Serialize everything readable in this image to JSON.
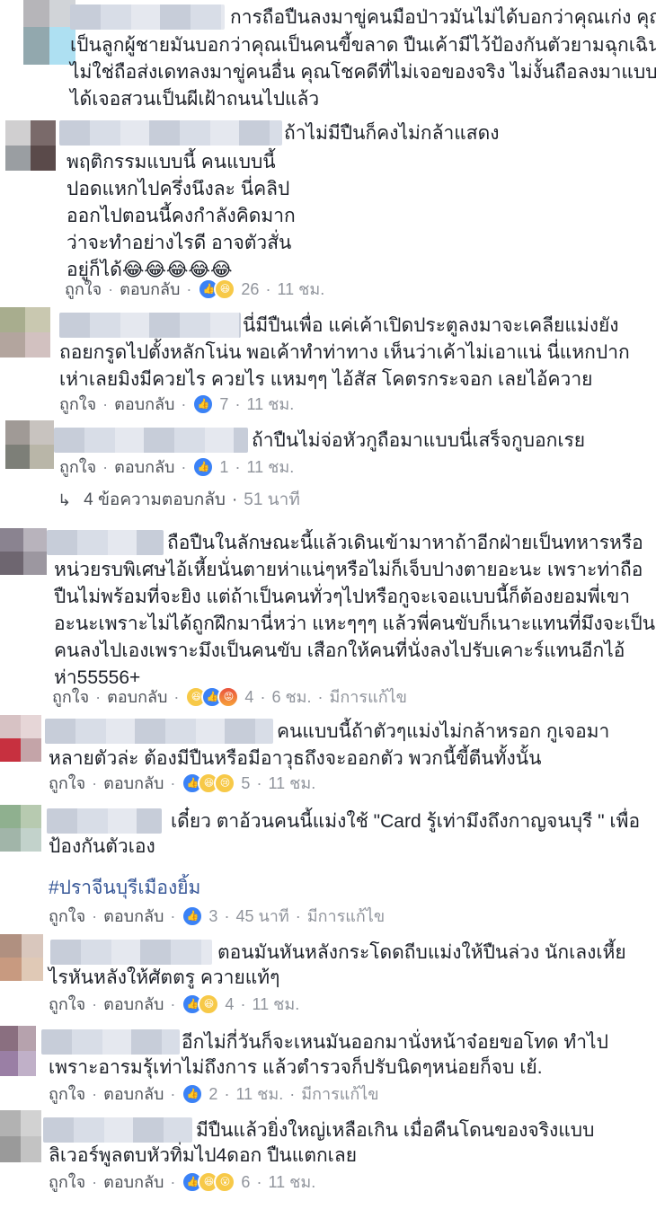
{
  "comments": [
    {
      "avatar_colors": [
        "#b6b5b9",
        "#d1d4d8",
        "#92a8ae",
        "#aee0f2"
      ],
      "text_lines": [
        "การถือปืนลงมาขู่คนมือป่าวมันไม่ได้บอกว่าคุณเก่ง คุณ",
        "เป็นลูกผู้ชายมันบอกว่าคุณเป็นคนขี้ขลาด ปืนเค้ามีไว้ป้องกันตัวยามฉุกเฉิน",
        "ไม่ใช่ถือส่งเดทลงมาขู่คนอื่น คุณโชคดีที่ไม่เจอของจริง ไม่งั้นถือลงมาแบบนี้",
        "ได้เจอสวนเป็นผีเฝ้าถนนไปแล้ว"
      ]
    },
    {
      "avatar_colors": [
        "#d0cfd0",
        "#7a6a6a",
        "#9a9ea2",
        "#5a4a4a"
      ],
      "text_lines": [
        "ถ้าไม่มีปืนก็คงไม่กล้าแสดง",
        "พฤติกรรมแบบนี้ คนแบบนี้",
        "ปอดแหกไปครึ่งนึงละ นี่คลิป",
        "ออกไปตอนนี้คงกำลังคิดมาก",
        "ว่าจะทำอย่างไรดี อาจตัวสั่น",
        "อยู่ก็ได้"
      ],
      "emoji_tail": "😂😂😂😂😂",
      "actions": {
        "like": "ถูกใจ",
        "reply": "ตอบกลับ"
      },
      "reactions": [
        "like",
        "haha"
      ],
      "count": "26",
      "time": "11 ชม."
    },
    {
      "avatar_colors": [
        "#a8ad8e",
        "#c9c8b0",
        "#b3a59e",
        "#d2c1c0"
      ],
      "text_lines": [
        "นี่มีปืนเพื่อ แค่เค้าเปิดประตูลงมาจะเคลียแม่งยัง",
        "ถอยกรูดไปตั้งหลักโน่น พอเค้าทำท่าทาง เห็นว่าเค้าไม่เอาแน่ นี่แหกปาก",
        "เห่าเลยมิงมีควยไร ควยไร แหมๆๆ ไอ้สัส โคตรกระจอก เลยไอ้ควาย"
      ],
      "actions": {
        "like": "ถูกใจ",
        "reply": "ตอบกลับ"
      },
      "reactions": [
        "like"
      ],
      "count": "7",
      "time": "11 ชม."
    },
    {
      "avatar_colors": [
        "#a09a96",
        "#c8c3bf",
        "#7d7f78",
        "#b9b6a8"
      ],
      "text_lines": [
        "ถ้าปืนไม่จ่อหัวกูถือมาแบบนี่เสร็จกูบอกเรย"
      ],
      "actions": {
        "like": "ถูกใจ",
        "reply": "ตอบกลับ"
      },
      "reactions": [
        "like"
      ],
      "count": "1",
      "time": "11 ชม."
    },
    {
      "avatar_colors": [
        "#8a8390",
        "#b8b3bc",
        "#6e6670",
        "#9c97a0"
      ],
      "text_lines": [
        "ถือปืนในลักษณะนี้แล้วเดินเข้ามาหาถ้าอีกฝ่ายเป็นทหารหรือ",
        "หน่วยรบพิเศษไอ้เหี้ยนั่นตายห่าแน่ๆหรือไม่ก็เจ็บปางตายอะนะ เพราะท่าถือ",
        "ปืนไม่พร้อมที่จะยิง แต่ถ้าเป็นคนทั่วๆไปหรือกูจะเจอแบบนี้ก็ต้องยอมพี่เขา",
        "อะนะเพราะไม่ได้ถูกฝึกมานี่หว่า แหะๆๆๆ แล้วพี่คนขับก็เนาะแทนที่มึงจะเป็น",
        "คนลงไปเองเพราะมึงเป็นคนขับ เสือกให้คนที่นั่งลงไปรับเคาะร์แทนอีกไอ้",
        "ห่า55556+"
      ],
      "actions": {
        "like": "ถูกใจ",
        "reply": "ตอบกลับ"
      },
      "reactions": [
        "haha",
        "like",
        "angry"
      ],
      "count": "4",
      "time": "6 ชม.",
      "edited": "มีการแก้ไข"
    },
    {
      "avatar_colors": [
        "#d7c2c4",
        "#e6d6d7",
        "#c7303f",
        "#c4a4a8"
      ],
      "text_lines": [
        "คนแบบนี้ถ้าตัวๆแม่งไม่กล้าหรอก กูเจอมา",
        "หลายตัวล่ะ ต้องมีปืนหรือมีอาวุธถึงจะออกตัว พวกนี้ขี้ตีนทั้งนั้น"
      ],
      "actions": {
        "like": "ถูกใจ",
        "reply": "ตอบกลับ"
      },
      "reactions": [
        "like",
        "haha",
        "sad"
      ],
      "count": "5",
      "time": "11 ชม."
    },
    {
      "avatar_colors": [
        "#8fb08f",
        "#b7cab0",
        "#a1b5a9",
        "#c2d2cb"
      ],
      "text_lines": [
        "เดี๋ยว ตาอ้วนคนนี้แม่งใช้ \"Card รู้เท่ามึงถึงกาญจนบุรี \" เพื่อ",
        "ป้องกันตัวเอง"
      ],
      "hashtag": "#ปราจีนบุรีเมืองยิ้ม",
      "actions": {
        "like": "ถูกใจ",
        "reply": "ตอบกลับ"
      },
      "reactions": [
        "like"
      ],
      "count": "3",
      "time": "45 นาที",
      "edited": "มีการแก้ไข"
    },
    {
      "avatar_colors": [
        "#b09080",
        "#d9c7bd",
        "#c89a80",
        "#e0c9b6"
      ],
      "text_lines": [
        "ตอนมันหันหลังกระโดดถีบแม่งให้ปืนล่วง นักเลงเหี้ย",
        "ไรหันหลังให้ศัตตรู ควายแท้ๆ"
      ],
      "actions": {
        "like": "ถูกใจ",
        "reply": "ตอบกลับ"
      },
      "reactions": [
        "like",
        "haha"
      ],
      "count": "4",
      "time": "11 ชม."
    },
    {
      "avatar_colors": [
        "#8a6f80",
        "#b6a2ad",
        "#9a7fa5",
        "#c0b0c8"
      ],
      "text_lines": [
        "อีกไม่กี่วันก็จะเหนมันออกมานั่งหน้าจ๋อยขอโทด ทำไป",
        "เพราะอารมรุ้เท่าไม่ถึงการ แล้วตำรวจก็ปรับนิดๆหน่อยก็จบ เย้."
      ],
      "actions": {
        "like": "ถูกใจ",
        "reply": "ตอบกลับ"
      },
      "reactions": [
        "like"
      ],
      "count": "2",
      "time": "11 ชม.",
      "edited": "มีการแก้ไข"
    },
    {
      "avatar_colors": [
        "#b2b2b2",
        "#d2d2d2",
        "#9a9a9a",
        "#c3c3c3"
      ],
      "text_lines": [
        "มีปืนแล้วยิ่งใหญ่เหลือเกิน เมื่อคืนโดนของจริงแบบ",
        "ลิเวอร์พูลตบหัวทิ่มไป4ดอก ปืนแตกเลย"
      ],
      "actions": {
        "like": "ถูกใจ",
        "reply": "ตอบกลับ"
      },
      "reactions": [
        "like",
        "haha",
        "wow"
      ],
      "count": "6",
      "time": "11 ชม."
    }
  ],
  "more_replies": {
    "label": "4 ข้อความตอบกลับ",
    "time": "51 นาที"
  },
  "icons": {
    "reply_arrow": "reply-arrow-icon",
    "like": "like-reaction-icon",
    "haha": "haha-reaction-icon",
    "sad": "sad-reaction-icon",
    "angry": "angry-reaction-icon",
    "wow": "wow-reaction-icon"
  },
  "colors": {
    "link": "#385898",
    "meta": "#90949c",
    "text": "#1d2129",
    "like_blue": "#3b82f6"
  }
}
